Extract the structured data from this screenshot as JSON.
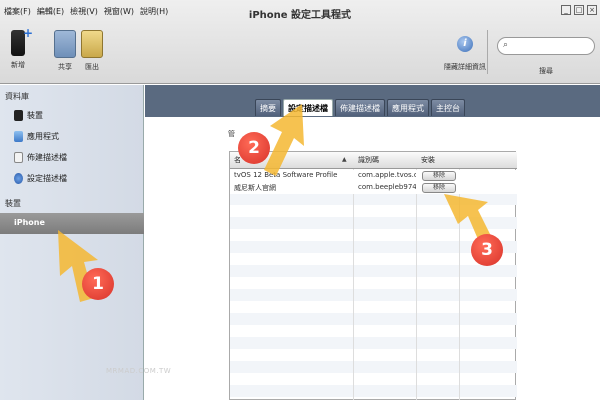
{
  "window": {
    "title": "iPhone 設定工具程式",
    "controls": [
      "_",
      "□",
      "×"
    ]
  },
  "menu": [
    "檔案(F)",
    "編輯(E)",
    "檢視(V)",
    "視窗(W)",
    "說明(H)"
  ],
  "toolbar": {
    "new_label": "新增",
    "share_label": "共享",
    "export_label": "匯出",
    "info_label": "隱藏詳細資訊",
    "search_label": "搜尋",
    "search_placeholder": ""
  },
  "sidebar": {
    "library_heading": "資料庫",
    "items": [
      {
        "label": "裝置",
        "icon": "phone-icon"
      },
      {
        "label": "應用程式",
        "icon": "apps-icon"
      },
      {
        "label": "佈建描述檔",
        "icon": "provisioning-icon"
      },
      {
        "label": "設定描述檔",
        "icon": "settings-icon"
      }
    ],
    "devices_heading": "裝置",
    "selected_device": "iPhone"
  },
  "tabs": [
    "摘要",
    "設定描述檔",
    "佈建描述檔",
    "應用程式",
    "主控台"
  ],
  "active_tab": 1,
  "section_label": "管",
  "table": {
    "columns": [
      "名",
      "識別碼",
      "安裝"
    ],
    "rows": [
      {
        "name": "tvOS 12 Beta Software Profile",
        "identifier": "com.apple.tvos.d...",
        "action": "移除"
      },
      {
        "name": "威尼斯人官網",
        "identifier": "com.beepleb974...",
        "action": "移除"
      }
    ]
  },
  "annotations": [
    "1",
    "2",
    "3"
  ],
  "accent_color": "#f5b731",
  "watermark": "MRMAD.COM.TW"
}
